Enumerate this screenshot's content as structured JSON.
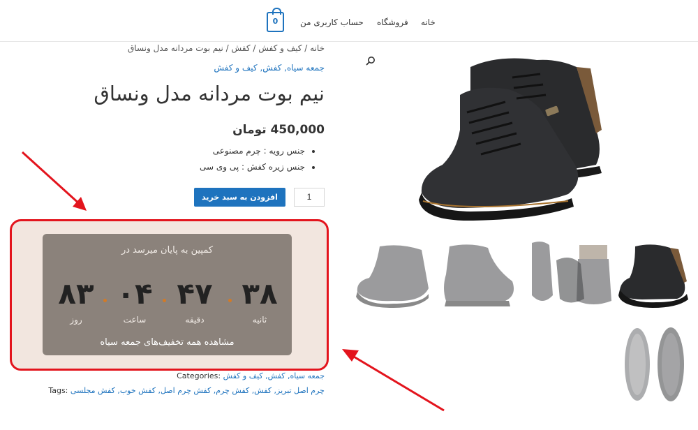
{
  "header": {
    "nav": [
      "خانه",
      "فروشگاه",
      "حساب کاربری من"
    ],
    "cart_count": "0"
  },
  "breadcrumb": "خانه / کیف و کفش / کفش / نیم بوت مردانه مدل ونساق",
  "category_links": "جمعه سیاه, کفش, کیف و کفش",
  "product": {
    "title": "نیم بوت مردانه مدل ونساق",
    "price": "450,000 تومان",
    "attributes": [
      "جنس رویه : چرم مصنوعی",
      "جنس زیره کفش : پی وی سی"
    ],
    "quantity": "1",
    "add_to_cart_label": "افزودن به سبد خرید"
  },
  "countdown": {
    "title": "کمپین به پایان میرسد در",
    "units": [
      {
        "value": "۸۳",
        "label": "روز"
      },
      {
        "value": "۰۴",
        "label": "ساعت"
      },
      {
        "value": "۴۷",
        "label": "دقیقه"
      },
      {
        "value": "۳۸",
        "label": "ثانیه"
      }
    ],
    "cta": "مشاهده همه تخفیف‌های جمعه سیاه"
  },
  "meta": {
    "categories_label": "Categories:",
    "categories_value": " جمعه سیاه, کفش, کیف و کفش",
    "tags_label": "Tags:",
    "tags_value": " چرم اصل تبریز, کفش, کفش چرم, کفش چرم اصل, کفش خوب, کفش مجلسی"
  },
  "colors": {
    "accent": "#1e73be",
    "highlight_frame": "#e3141d",
    "timer_bg": "#8b827b"
  },
  "icons": [
    "search-icon",
    "cart-icon"
  ]
}
